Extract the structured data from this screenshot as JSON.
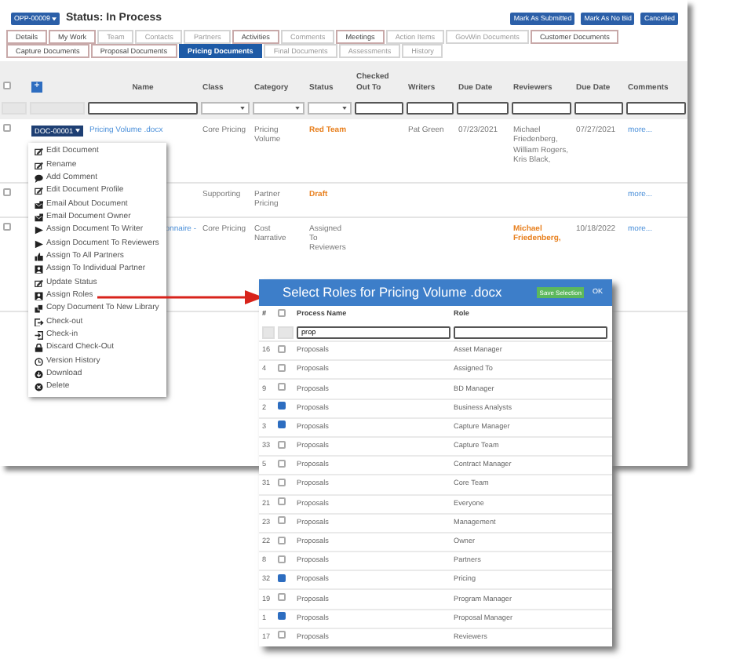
{
  "header": {
    "opp_button": "OPP-00009",
    "status": "Status: In Process",
    "actions": [
      "Mark As Submitted",
      "Mark As No Bid",
      "Cancelled"
    ]
  },
  "tabs": [
    {
      "label": "Details",
      "selected": false,
      "dimmed": false
    },
    {
      "label": "My Work",
      "selected": false,
      "dimmed": false
    },
    {
      "label": "Team",
      "selected": false,
      "dimmed": true
    },
    {
      "label": "Contacts",
      "selected": false,
      "dimmed": true
    },
    {
      "label": "Partners",
      "selected": false,
      "dimmed": true
    },
    {
      "label": "Activities",
      "selected": false,
      "dimmed": false
    },
    {
      "label": "Comments",
      "selected": false,
      "dimmed": true
    },
    {
      "label": "Meetings",
      "selected": false,
      "dimmed": false
    },
    {
      "label": "Action Items",
      "selected": false,
      "dimmed": true
    },
    {
      "label": "GovWin Documents",
      "selected": false,
      "dimmed": true
    },
    {
      "label": "Customer Documents",
      "selected": false,
      "dimmed": false
    },
    {
      "label": "Capture Documents",
      "selected": false,
      "dimmed": false
    },
    {
      "label": "Proposal Documents",
      "selected": false,
      "dimmed": false
    },
    {
      "label": "Pricing Documents",
      "selected": true,
      "dimmed": false
    },
    {
      "label": "Final Documents",
      "selected": false,
      "dimmed": true
    },
    {
      "label": "Assessments",
      "selected": false,
      "dimmed": true
    },
    {
      "label": "History",
      "selected": false,
      "dimmed": true
    }
  ],
  "table": {
    "add_button": "+",
    "all_checked": false,
    "columns": [
      {
        "label": "Name",
        "kind": "text"
      },
      {
        "label": "Class",
        "kind": "select"
      },
      {
        "label": "Category",
        "kind": "select"
      },
      {
        "label": "Status",
        "kind": "select"
      },
      {
        "label": "Checked Out To",
        "kind": "text"
      },
      {
        "label": "Writers",
        "kind": "text"
      },
      {
        "label": "Due Date",
        "kind": "text"
      },
      {
        "label": "Reviewers",
        "kind": "text"
      },
      {
        "label": "Due Date",
        "kind": "text"
      },
      {
        "label": "Comments",
        "kind": "text"
      }
    ],
    "rows": [
      {
        "checked": false,
        "doc_button": "DOC-00001",
        "name": "Pricing Volume .docx",
        "class": "Core Pricing",
        "category": "Pricing Volume",
        "status": "Red Team",
        "status_highlighted": true,
        "writers": "Pat Green",
        "due_date": "07/23/2021",
        "reviewers": "Michael Friedenberg, William Rogers, Kris Black,",
        "reviewers_highlighted": false,
        "review_due_date": "07/27/2021",
        "comments": "more..."
      },
      {
        "checked": false,
        "class": "Supporting",
        "category": "Partner Pricing",
        "status": "Draft",
        "status_highlighted": true,
        "comments": "more..."
      },
      {
        "checked": false,
        "name": "onnaire -",
        "name_clipped_left": true,
        "class": "Core Pricing",
        "category": "Cost Narrative",
        "status": "Assigned To Reviewers",
        "status_highlighted": false,
        "reviewers": "Michael Friedenberg,",
        "reviewers_highlighted": true,
        "review_due_date": "10/18/2022",
        "comments": "more..."
      }
    ]
  },
  "context_menu": {
    "items": [
      {
        "label": "Edit Document",
        "kind": "edit"
      },
      {
        "label": "Rename",
        "kind": "edit"
      },
      {
        "label": "Add Comment",
        "kind": "comment"
      },
      {
        "label": "Edit Document Profile",
        "kind": "edit"
      },
      {
        "label": "Email About Document",
        "kind": "email"
      },
      {
        "label": "Email Document Owner",
        "kind": "email"
      },
      {
        "label": "Assign Document To Writer",
        "kind": "assign"
      },
      {
        "label": "Assign Document To Reviewers",
        "kind": "assign"
      },
      {
        "label": "Assign To All Partners",
        "kind": "partners"
      },
      {
        "label": "Assign To Individual Partner",
        "kind": "person"
      },
      {
        "label": "Update Status",
        "kind": "edit"
      },
      {
        "label": "Assign Roles",
        "kind": "person"
      },
      {
        "label": "Copy Document To New Library",
        "kind": "copy"
      },
      {
        "label": "Check-out",
        "kind": "checkout"
      },
      {
        "label": "Check-in",
        "kind": "checkin"
      },
      {
        "label": "Discard Check-Out",
        "kind": "lock"
      },
      {
        "label": "Version History",
        "kind": "history"
      },
      {
        "label": "Download",
        "kind": "download"
      },
      {
        "label": "Delete",
        "kind": "delete"
      }
    ]
  },
  "dialog": {
    "title": "Select Roles for Pricing Volume .docx",
    "save_button": "Save Selection",
    "ok_button": "OK",
    "columns": [
      "#",
      "Process Name",
      "Role"
    ],
    "all_checked": false,
    "process_filter": "prop",
    "rows": [
      {
        "id": "16",
        "checked": false,
        "process": "Proposals",
        "role": "Asset Manager"
      },
      {
        "id": "4",
        "checked": false,
        "process": "Proposals",
        "role": "Assigned To"
      },
      {
        "id": "9",
        "checked": false,
        "process": "Proposals",
        "role": "BD Manager"
      },
      {
        "id": "2",
        "checked": true,
        "process": "Proposals",
        "role": "Business Analysts"
      },
      {
        "id": "3",
        "checked": true,
        "process": "Proposals",
        "role": "Capture Manager"
      },
      {
        "id": "33",
        "checked": false,
        "process": "Proposals",
        "role": "Capture Team"
      },
      {
        "id": "5",
        "checked": false,
        "process": "Proposals",
        "role": "Contract Manager"
      },
      {
        "id": "31",
        "checked": false,
        "process": "Proposals",
        "role": "Core Team"
      },
      {
        "id": "21",
        "checked": false,
        "process": "Proposals",
        "role": "Everyone"
      },
      {
        "id": "23",
        "checked": false,
        "process": "Proposals",
        "role": "Management"
      },
      {
        "id": "22",
        "checked": false,
        "process": "Proposals",
        "role": "Owner"
      },
      {
        "id": "8",
        "checked": false,
        "process": "Proposals",
        "role": "Partners"
      },
      {
        "id": "32",
        "checked": true,
        "process": "Proposals",
        "role": "Pricing"
      },
      {
        "id": "19",
        "checked": false,
        "process": "Proposals",
        "role": "Program Manager"
      },
      {
        "id": "1",
        "checked": true,
        "process": "Proposals",
        "role": "Proposal Manager"
      },
      {
        "id": "17",
        "checked": false,
        "process": "Proposals",
        "role": "Reviewers"
      }
    ]
  }
}
